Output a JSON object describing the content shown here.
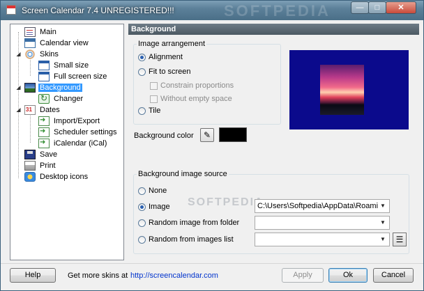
{
  "window": {
    "title": "Screen Calendar 7.4 UNREGISTERED!!!",
    "watermark": "SOFTPEDIA",
    "controls": {
      "minimize": "—",
      "maximize": "□",
      "close": "✕"
    }
  },
  "tree": [
    {
      "label": "Main",
      "icon": "main-doc-icon"
    },
    {
      "label": "Calendar view",
      "icon": "calendar-icon"
    },
    {
      "label": "Skins",
      "icon": "skins-icon"
    },
    {
      "label": "Small size",
      "icon": "window-icon"
    },
    {
      "label": "Full screen size",
      "icon": "window-icon"
    },
    {
      "label": "Background",
      "icon": "background-icon",
      "selected": true
    },
    {
      "label": "Changer",
      "icon": "changer-icon"
    },
    {
      "label": "Dates",
      "icon": "dates-icon"
    },
    {
      "label": "Import/Export",
      "icon": "arrow-icon"
    },
    {
      "label": "Scheduler settings",
      "icon": "arrow-icon"
    },
    {
      "label": "iCalendar (iCal)",
      "icon": "arrow-icon"
    },
    {
      "label": "Save",
      "icon": "save-icon"
    },
    {
      "label": "Print",
      "icon": "print-icon"
    },
    {
      "label": "Desktop icons",
      "icon": "desktop-icon"
    }
  ],
  "panel": {
    "header": "Background",
    "arrangement": {
      "title": "Image arrangement",
      "alignment": "Alignment",
      "fit": "Fit to screen",
      "constrain": "Constrain proportions",
      "no_empty": "Without empty space",
      "tile": "Tile",
      "selected": "Alignment"
    },
    "bg_color_label": "Background color",
    "bg_color": "#000000",
    "preview_bg": "#0b0a8c",
    "source": {
      "title": "Background image source",
      "none": "None",
      "image": "Image",
      "random_folder": "Random image from folder",
      "random_list": "Random from images list",
      "image_path": "C:\\Users\\Softpedia\\AppData\\Roaming",
      "folder_value": "",
      "list_value": "",
      "selected": "Image"
    }
  },
  "footer": {
    "help": "Help",
    "skins_text": "Get more skins at",
    "skins_link": "http://screencalendar.com",
    "apply": "Apply",
    "ok": "Ok",
    "cancel": "Cancel"
  }
}
